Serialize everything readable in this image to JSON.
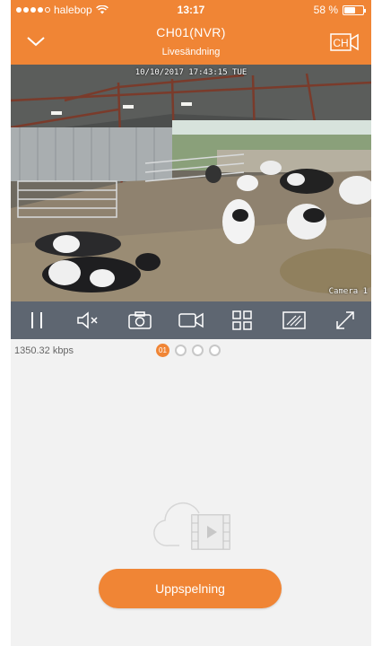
{
  "status_bar": {
    "carrier": "halebop",
    "time": "13:17",
    "battery": "58 %",
    "battery_level": 0.58
  },
  "header": {
    "title": "CH01(NVR)",
    "subtitle": "Livesändning",
    "back_icon": "chevron-down-icon",
    "channel_icon": "channel-camera-icon"
  },
  "video": {
    "timestamp": "10/10/2017 17:43:15 TUE",
    "camera_label": "Camera 1"
  },
  "toolbar": {
    "buttons": [
      "pause-icon",
      "mute-icon",
      "snapshot-icon",
      "record-icon",
      "grid-icon",
      "quality-icon",
      "fullscreen-icon"
    ]
  },
  "info": {
    "bitrate": "1350.32 kbps"
  },
  "pager": {
    "pages": [
      "01",
      "",
      "",
      ""
    ],
    "active_index": 0
  },
  "playback": {
    "label": "Uppspelning"
  },
  "colors": {
    "accent": "#f08535",
    "toolbar": "#5e6671"
  }
}
